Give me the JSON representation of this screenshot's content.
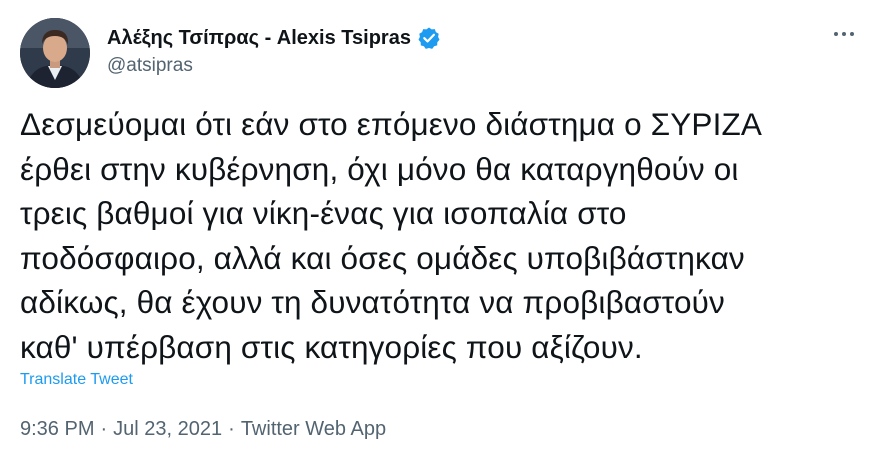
{
  "author": {
    "display_name": "Αλέξης Τσίπρας - Alexis Tsipras",
    "handle": "@atsipras",
    "verified": true,
    "avatar_icon": "profile-photo"
  },
  "menu_icon": "more-dots-icon",
  "tweet": {
    "lines": [
      "Δεσμεύομαι ότι εάν στο επόμενο διάστημα ο ΣΥΡΙΖΑ",
      "έρθει στην κυβέρνηση, όχι μόνο θα καταργηθούν οι",
      "τρεις βαθμοί για νίκη-ένας για ισοπαλία στο",
      "ποδόσφαιρο, αλλά και όσες ομάδες υποβιβάστηκαν",
      "αδίκως, θα έχουν τη δυνατότητα να προβιβαστούν",
      "καθ' υπέρβαση στις κατηγορίες που αξίζουν."
    ],
    "translate_label": "Translate Tweet"
  },
  "meta": {
    "time": "9:36 PM",
    "separator": "·",
    "date": "Jul 23, 2021",
    "source": "Twitter Web App"
  },
  "colors": {
    "accent": "#1d9bf0",
    "text": "#0f1419",
    "muted": "#536471"
  }
}
